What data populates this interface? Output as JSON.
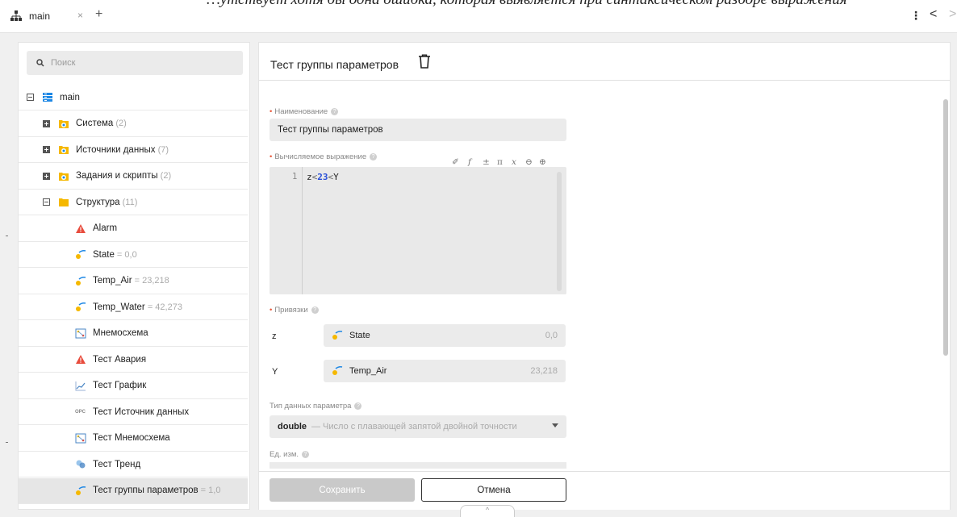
{
  "window": {
    "tab_title": "main",
    "tab_close": "×",
    "tab_add": "+",
    "top_text": "…утствует хотя бы одна ошибка, которая выявляется при синтаксическом разборе выражения",
    "kebab": "⋮",
    "back": "<",
    "forward": ">"
  },
  "sidebar": {
    "search_placeholder": "Поиск",
    "tree": [
      {
        "label": "main",
        "count": "",
        "icon": "db-icon",
        "toggle": "minus"
      },
      {
        "label": "Система",
        "count": " (2)",
        "icon": "folder-gear-icon",
        "toggle": "plus-filled"
      },
      {
        "label": "Источники данных",
        "count": " (7)",
        "icon": "folder-gear-icon",
        "toggle": "plus-filled"
      },
      {
        "label": "Задания и скрипты",
        "count": " (2)",
        "icon": "folder-gear-icon",
        "toggle": "plus-filled"
      },
      {
        "label": "Структура",
        "count": " (11)",
        "icon": "folder-icon",
        "toggle": "minus"
      },
      {
        "label": "Alarm",
        "count": "",
        "icon": "alarm-icon",
        "toggle": ""
      },
      {
        "label": "State",
        "count": " = 0,0",
        "icon": "parameter-icon",
        "toggle": ""
      },
      {
        "label": "Temp_Air",
        "count": " = 23,218",
        "icon": "parameter-icon",
        "toggle": ""
      },
      {
        "label": "Temp_Water",
        "count": " = 42,273",
        "icon": "parameter-icon",
        "toggle": ""
      },
      {
        "label": "Мнемосхема",
        "count": "",
        "icon": "mnemonic-icon",
        "toggle": ""
      },
      {
        "label": "Тест Авария",
        "count": "",
        "icon": "alarm-icon",
        "toggle": ""
      },
      {
        "label": "Тест График",
        "count": "",
        "icon": "chart-icon",
        "toggle": ""
      },
      {
        "label": "Тест Источник данных",
        "count": "",
        "icon": "opc-icon",
        "toggle": ""
      },
      {
        "label": "Тест Мнемосхема",
        "count": "",
        "icon": "mnemonic-icon",
        "toggle": ""
      },
      {
        "label": "Тест Тренд",
        "count": "",
        "icon": "trend-icon",
        "toggle": ""
      },
      {
        "label": "Тест группы параметров",
        "count": " = 1,0",
        "icon": "parameter-icon",
        "toggle": ""
      }
    ],
    "opc_glyph": "OPC"
  },
  "editor": {
    "title": "Тест группы параметров",
    "name_label": "Наименование",
    "name_value": "Тест группы параметров",
    "expr_label": "Вычисляемое выражение",
    "expr_line_number": "1",
    "expr_tokens": {
      "a": "z",
      "op1": "<",
      "num": "23",
      "op2": "<",
      "b": "Y"
    },
    "toolbar": {
      "magic": "✐",
      "f": "f",
      "pm": "±",
      "pi": "π",
      "x": "x",
      "zoom_out": "⊖",
      "zoom_in": "⊕"
    },
    "bindings_label": "Привязки",
    "bindings": [
      {
        "var": "z",
        "param": "State",
        "value": "0,0"
      },
      {
        "var": "Y",
        "param": "Temp_Air",
        "value": "23,218"
      }
    ],
    "type_label": "Тип данных параметра",
    "type_value": "double",
    "type_desc": "— Число с плавающей запятой двойной точности",
    "units_label": "Ед. изм.",
    "help_glyph": "?",
    "required_mark": "•",
    "save": "Сохранить",
    "cancel": "Отмена",
    "collapse": "^"
  },
  "colors": {
    "accent_required": "#e8583a",
    "folder": "#f5b800",
    "alarm": "#e84c3d",
    "db": "#1e88e5"
  }
}
